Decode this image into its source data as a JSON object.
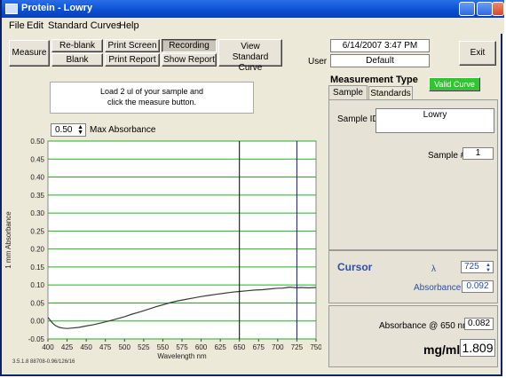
{
  "window": {
    "title": "Protein - Lowry"
  },
  "menu": [
    "File",
    "Edit",
    "Standard Curves",
    "Help"
  ],
  "toolbar": {
    "measure": "Measure",
    "reblank": "Re-blank",
    "blank": "Blank",
    "print_screen": "Print Screen",
    "print_report": "Print Report",
    "recording": "Recording",
    "show_report": "Show Report",
    "view_std_line1": "View",
    "view_std_line2": "Standard Curve",
    "datetime": "6/14/2007 3:47 PM",
    "user_label": "User",
    "user_value": "Default",
    "exit": "Exit"
  },
  "instruction": {
    "line1": "Load 2 ul of your sample and",
    "line2": "click the measure button."
  },
  "max_abs": {
    "value": "0.50",
    "label": "Max Absorbance"
  },
  "measurement": {
    "title": "Measurement Type",
    "tabs": [
      "Sample",
      "Standards"
    ],
    "valid_curve": "Valid Curve",
    "sample_id_label": "Sample ID",
    "sample_id_value": "Lowry",
    "sample_num_label": "Sample #",
    "sample_num_value": "1"
  },
  "cursor": {
    "title": "Cursor",
    "lambda_symbol": "λ",
    "lambda_value": "725",
    "absorbance_label": "Absorbance",
    "absorbance_value": "0.092"
  },
  "result": {
    "abs650_label": "Absorbance @ 650 nm",
    "abs650_value": "0.082",
    "unit": "mg/ml",
    "value": "1.809"
  },
  "version": "3.5.1.8 88708-0.96/126/16",
  "colors": {
    "grid": "#22b022",
    "curve": "#3a3a3a",
    "marker650": "#000000",
    "cursor725": "#1a1a6a",
    "valid": "#2ec82e",
    "accent_blue": "#2a4fb0"
  },
  "chart_data": {
    "type": "line",
    "xlabel": "Wavelength  nm",
    "ylabel": "1 mm Absorbance",
    "xlim": [
      400,
      750
    ],
    "ylim": [
      -0.05,
      0.5
    ],
    "xticks": [
      "400",
      "425",
      "450",
      "475",
      "500",
      "525",
      "550",
      "575",
      "600",
      "625",
      "650",
      "675",
      "700",
      "725",
      "750"
    ],
    "yticks": [
      "0.50",
      "0.45",
      "0.40",
      "0.35",
      "0.30",
      "0.25",
      "0.20",
      "0.15",
      "0.10",
      "0.05",
      "0.00",
      "-0.05"
    ],
    "grid": true,
    "series": [
      {
        "x": [
          400,
          403,
          406,
          410,
          415,
          420,
          425,
          430,
          440,
          450,
          460,
          470,
          480,
          490,
          500,
          510,
          520,
          530,
          540,
          550,
          560,
          570,
          580,
          590,
          600,
          610,
          620,
          630,
          640,
          650,
          660,
          670,
          680,
          690,
          700,
          705,
          710,
          715,
          720,
          725,
          730,
          740,
          750
        ],
        "y": [
          0.01,
          0.002,
          -0.006,
          -0.013,
          -0.018,
          -0.02,
          -0.021,
          -0.02,
          -0.018,
          -0.014,
          -0.01,
          -0.005,
          0.0,
          0.006,
          0.012,
          0.019,
          0.025,
          0.032,
          0.039,
          0.045,
          0.051,
          0.056,
          0.06,
          0.064,
          0.068,
          0.071,
          0.074,
          0.077,
          0.08,
          0.082,
          0.084,
          0.086,
          0.087,
          0.089,
          0.091,
          0.091,
          0.092,
          0.094,
          0.093,
          0.092,
          0.093,
          0.092,
          0.093
        ]
      }
    ],
    "markers": [
      650,
      725
    ]
  }
}
